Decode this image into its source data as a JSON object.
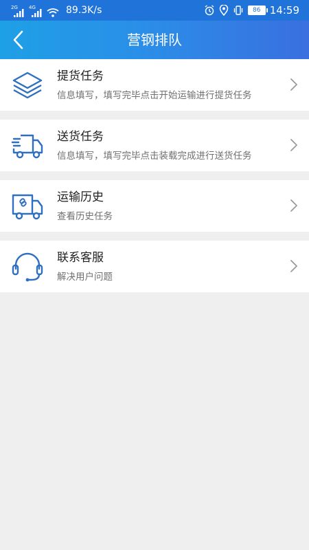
{
  "status_bar": {
    "sim1_label": "2G",
    "sim2_label": "4G",
    "net_speed": "89.3K/s",
    "battery_level": "86",
    "clock": "14:59"
  },
  "header": {
    "title": "营钢排队"
  },
  "menu": [
    {
      "title": "提货任务",
      "desc": "信息填写，填写完毕点击开始运输进行提货任务",
      "icon": "layers-icon"
    },
    {
      "title": "送货任务",
      "desc": "信息填写，填写完毕点击装载完成进行送货任务",
      "icon": "delivery-truck-icon"
    },
    {
      "title": "运输历史",
      "desc": "查看历史任务",
      "icon": "truck-history-icon"
    },
    {
      "title": "联系客服",
      "desc": "解决用户问题",
      "icon": "headset-icon"
    }
  ],
  "colors": {
    "accent_blue": "#1f73d9",
    "icon_blue": "#2f6fbf",
    "background": "#efefef"
  }
}
